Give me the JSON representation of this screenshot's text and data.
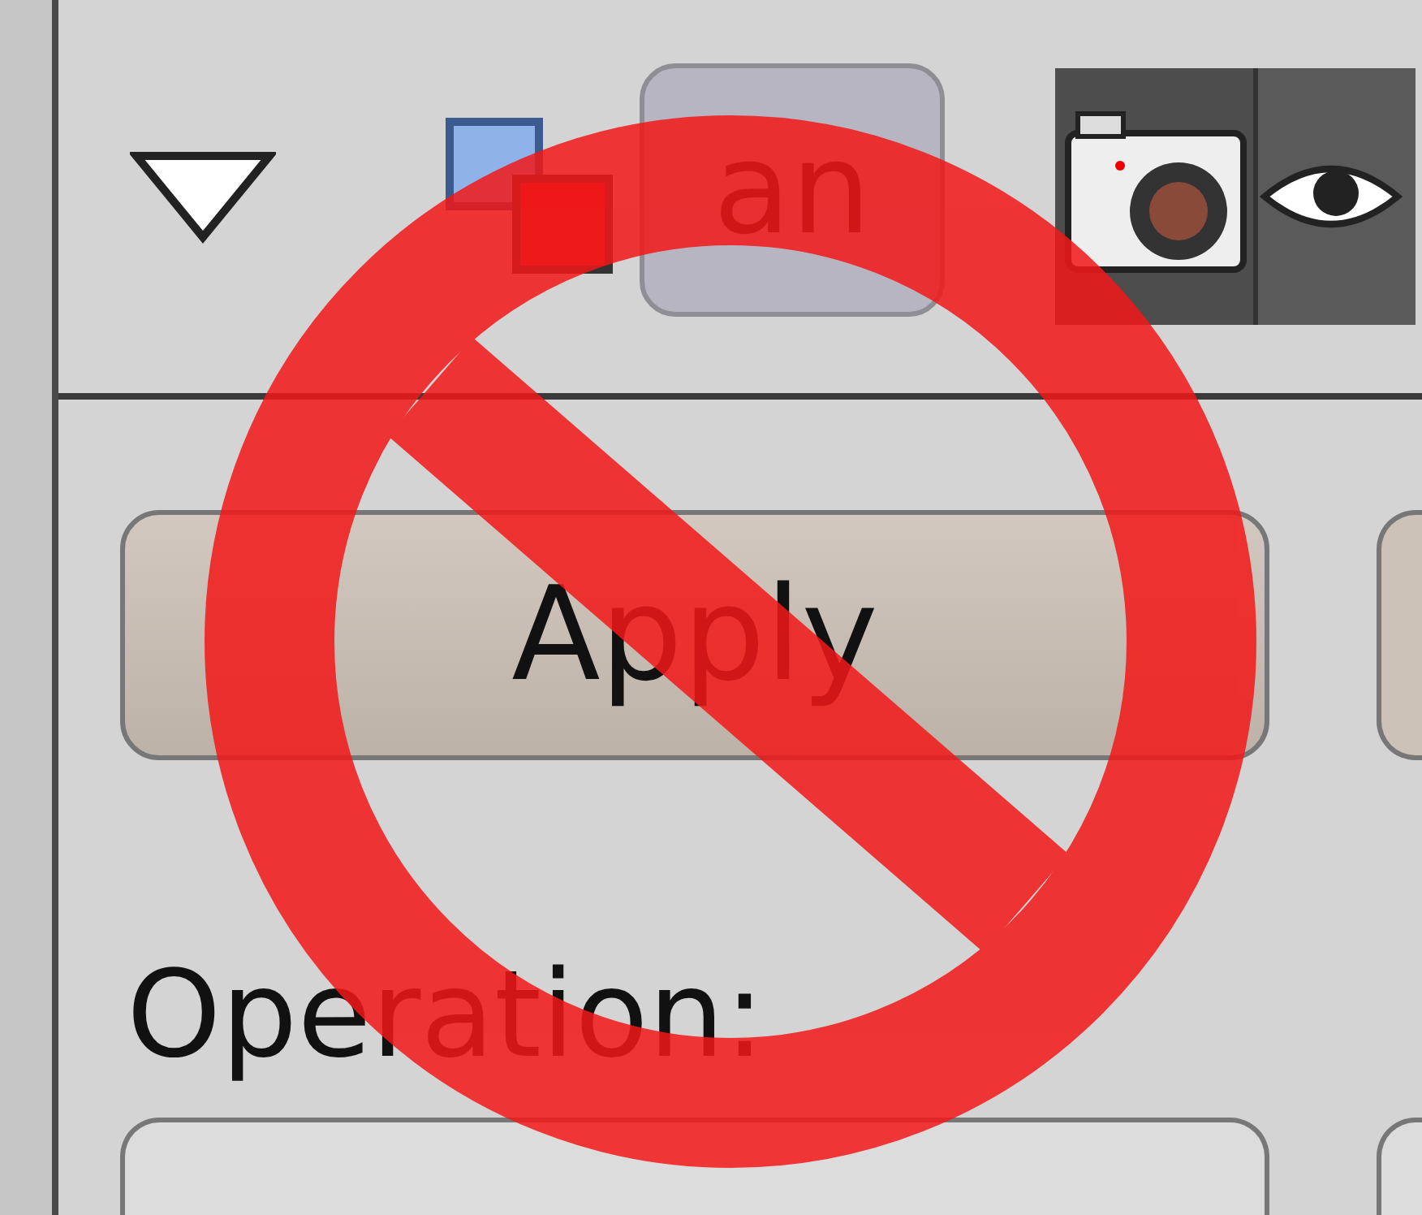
{
  "header": {
    "layer_button": {
      "label": "an"
    }
  },
  "apply_button": {
    "label": "Apply"
  },
  "operation": {
    "label": "Operation:"
  }
}
